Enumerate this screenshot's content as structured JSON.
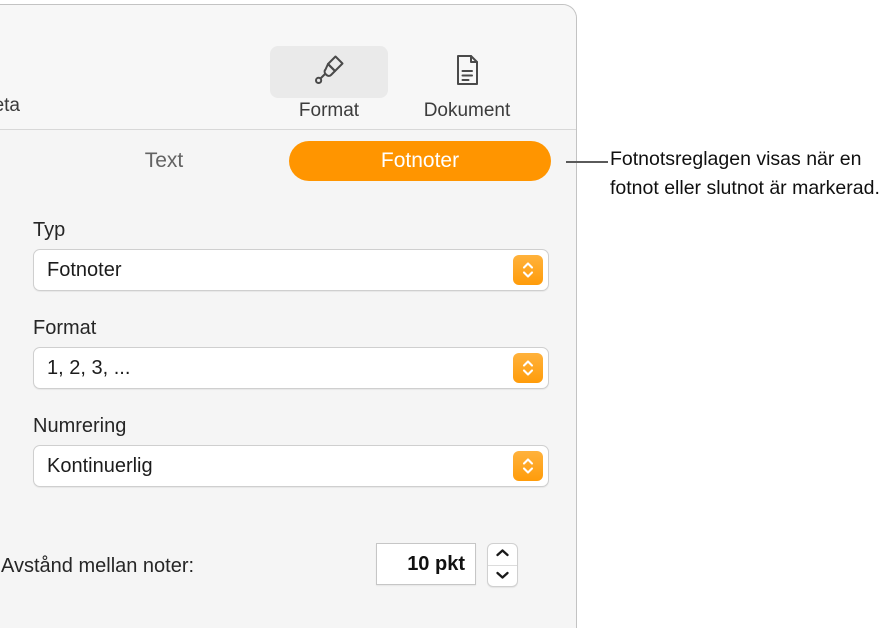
{
  "panel": {
    "toolbar": {
      "left_label": "beta",
      "items": [
        {
          "label": "Format",
          "icon": "paintbrush-icon",
          "active": true
        },
        {
          "label": "Dokument",
          "icon": "document-page-icon",
          "active": false
        }
      ]
    },
    "tabs": [
      {
        "label": "Text",
        "selected": false
      },
      {
        "label": "Fotnoter",
        "selected": true
      }
    ],
    "fields": [
      {
        "label": "Typ",
        "value": "Fotnoter",
        "control": "popup-button"
      },
      {
        "label": "Format",
        "value": "1, 2, 3, ...",
        "control": "popup-button"
      },
      {
        "label": "Numrering",
        "value": "Kontinuerlig",
        "control": "popup-button"
      }
    ],
    "spacing": {
      "label": "Avstånd mellan noter:",
      "value": "10 pkt"
    }
  },
  "callout": {
    "text": "Fotnotsreglagen visas när en fotnot eller slutnot är markerad."
  },
  "colors": {
    "accent_orange": "#ff9500",
    "panel_background": "#f5f5f5",
    "toolbar_background": "#f7f7f7",
    "text_primary": "#1c1c1c"
  }
}
